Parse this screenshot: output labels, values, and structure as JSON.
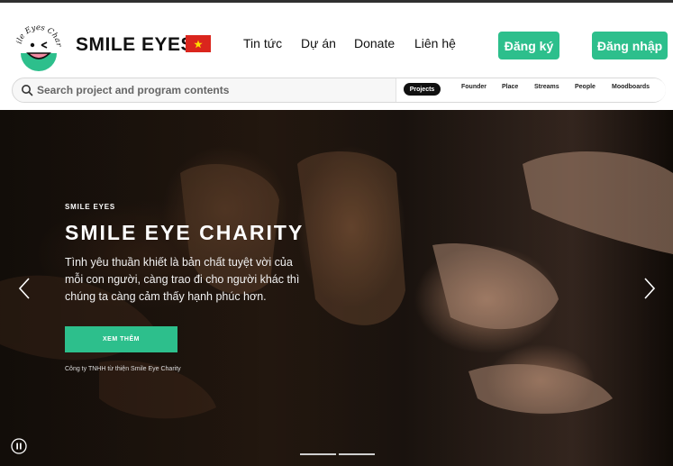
{
  "brand": {
    "logo_text": "Smile Eyes Charity",
    "name": "SMILE EYES",
    "flag_icon": "vietnam-flag-icon"
  },
  "nav": {
    "news": "Tin tức",
    "projects": "Dự án",
    "donate": "Donate",
    "contact": "Liên hệ"
  },
  "auth": {
    "register": "Đăng ký",
    "login": "Đăng nhập"
  },
  "search": {
    "placeholder": "Search project and program contents",
    "filters": [
      "Projects",
      "Founder",
      "Place",
      "Streams",
      "People",
      "Moodboards"
    ],
    "active_filter": "Projects"
  },
  "hero": {
    "kicker": "SMILE EYES",
    "title": "SMILE EYE CHARITY",
    "description": "Tình yêu thuần khiết là bản chất tuyệt vời của mỗi con người, càng trao đi cho người khác thì chúng ta càng cảm thấy hạnh phúc hơn.",
    "cta": "XEM THÊM",
    "caption": "Công ty TNHH từ thiện Smile Eye Charity"
  },
  "colors": {
    "accent": "#2dbf8c",
    "flag_red": "#da251d",
    "flag_star": "#ffde00"
  },
  "slider": {
    "slides": 2
  }
}
